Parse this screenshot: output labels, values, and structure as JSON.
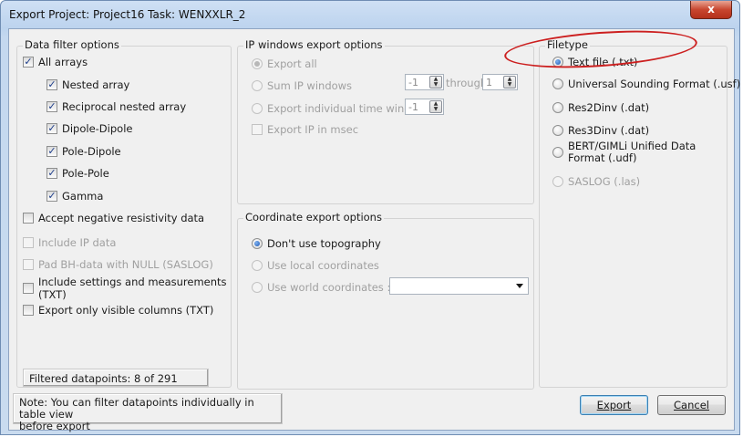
{
  "window": {
    "title": "Export Project: Project16 Task: WENXXLR_2",
    "close_glyph": "x"
  },
  "data_filter": {
    "legend": "Data filter options",
    "all_arrays": "All arrays",
    "arrays": [
      "Nested array",
      "Reciprocal nested array",
      "Dipole-Dipole",
      "Pole-Dipole",
      "Pole-Pole",
      "Gamma"
    ],
    "accept_negative": "Accept negative resistivity data",
    "include_ip": "Include IP data",
    "pad_bh": "Pad BH-data with NULL (SASLOG)",
    "include_settings_line1": "Include settings and measurements",
    "include_settings_line2": "(TXT)",
    "export_visible": "Export only visible columns (TXT)",
    "filtered_text": "Filtered datapoints: 8 of 291"
  },
  "ip_windows": {
    "legend": "IP windows export options",
    "export_all": "Export all",
    "sum_ip": "Sum IP windows",
    "sum_from": "-1",
    "through_label": "through",
    "sum_to": "1",
    "export_individual": "Export individual time window",
    "individual_value": "-1",
    "export_msec": "Export IP in msec"
  },
  "coordinates": {
    "legend": "Coordinate export options",
    "dont_use_topo": "Don't use topography",
    "use_local": "Use local coordinates",
    "use_world": "Use world coordinates :",
    "world_value": ""
  },
  "filetype": {
    "legend": "Filetype",
    "options": [
      "Text file (.txt)",
      "Universal Sounding Format (.usf)",
      "Res2Dinv (.dat)",
      "Res3Dinv (.dat)",
      "BERT/GIMLi Unified Data",
      "Format (.udf)",
      "SASLOG (.las)"
    ]
  },
  "note": {
    "line1": "Note: You can filter datapoints individually in table view",
    "line2": "before export"
  },
  "buttons": {
    "export": "Export",
    "cancel": "Cancel"
  },
  "colors": {
    "annotation_circle": "#cc1f1f",
    "selected_radio": "#1d57b5"
  }
}
